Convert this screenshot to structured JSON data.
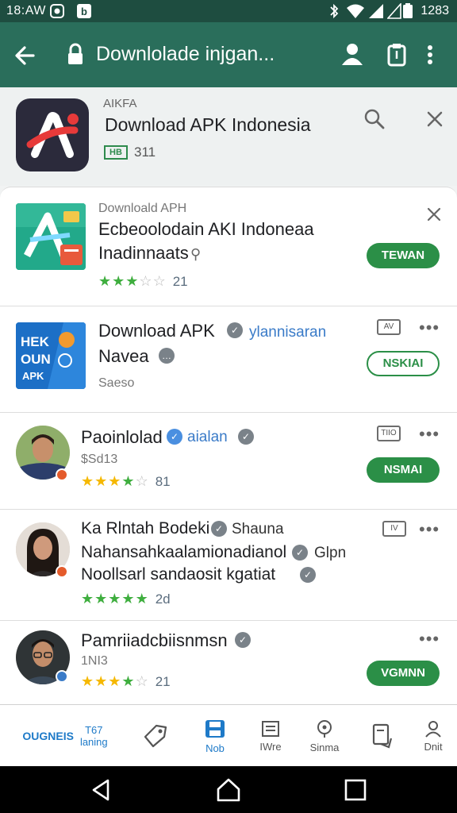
{
  "status_bar": {
    "time": "18:AW",
    "battery_time": "1283"
  },
  "url_bar": {
    "url_text": "Downlolade injgan..."
  },
  "header": {
    "subtitle": "AIKFA",
    "title": "Download APK Indonesia",
    "badge": "HB",
    "count": "311"
  },
  "list": [
    {
      "category": "Downloald APH",
      "title_line1": "Ecbeoolodain AKI Indoneaa",
      "title_line2": "Inadinnaats",
      "rating": 3.5,
      "rating_count": "21",
      "button": "TEWAN",
      "thumb_text": ""
    },
    {
      "title_line1": "Download APK",
      "title_extra": "ylannisaran",
      "title_line2": "Navea",
      "size": "Saeso",
      "mini_badge": "AV",
      "button": "NSKIAI",
      "thumb_text_1": "HEK",
      "thumb_text_2": "OUN",
      "thumb_text_3": "APK"
    },
    {
      "title": "Paoinlolad",
      "title_extra": "aialan",
      "size": "$Sd13",
      "rating": 3.5,
      "rating_count": "81",
      "mini_badge": "TIIO",
      "button": "NSMAI"
    },
    {
      "title_line1": "Ka Rlntah Bodeki",
      "title_line1_extra": "Shauna",
      "title_line2": "Nahansahkaalamionadianol",
      "title_line2_extra": "Glpn",
      "title_line3": "Noollsarl sandaosit kgatiat",
      "rating": 4.5,
      "rating_count": "2d",
      "mini_badge": "IV"
    },
    {
      "title": "Pamriiadcbiisnmsn",
      "size": "1NI3",
      "rating": 3.5,
      "rating_count": "21",
      "button": "VGMNN"
    }
  ],
  "bottom_nav": {
    "left_label": "OUGNEIS",
    "left_sub_top": "T67",
    "left_sub_bottom": "laning",
    "items": [
      "Nob",
      "IWre",
      "Sinma",
      "Dnit"
    ]
  },
  "colors": {
    "statusbar": "#1e4d40",
    "toolbar": "#2a6e5b",
    "accent_green": "#2b8f47",
    "accent_blue": "#1e7ac8",
    "star_yellow": "#f5b800",
    "star_green": "#3fae3f"
  }
}
